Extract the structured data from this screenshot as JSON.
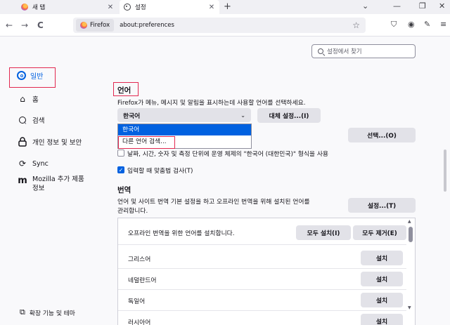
{
  "tabs": [
    {
      "title": "새 탭",
      "close": "✕"
    },
    {
      "title": "설정",
      "close": "✕"
    }
  ],
  "tabstrip": {
    "new_tab": "+",
    "list_all": "⌄",
    "minimize": "—",
    "restore": "❐",
    "close": "✕"
  },
  "nav": {
    "back": "←",
    "forward": "→",
    "reload": "C",
    "identity_label": "Firefox",
    "url": "about:preferences",
    "star": "☆",
    "icons": [
      "pocket-icon",
      "account-icon",
      "extensions-icon",
      "menu-icon"
    ]
  },
  "search": {
    "placeholder": "설정에서 찾기"
  },
  "sidebar": {
    "items": [
      {
        "label": "일반",
        "icon": "gear-icon",
        "selected": true
      },
      {
        "label": "홈",
        "icon": "home-icon"
      },
      {
        "label": "검색",
        "icon": "search-icon"
      },
      {
        "label": "개인 정보 및 보안",
        "icon": "lock-icon"
      },
      {
        "label": "Sync",
        "icon": "sync-icon"
      },
      {
        "label": "Mozilla 추가 제품",
        "label2": "정보",
        "icon": "mozilla-icon"
      }
    ],
    "bottom": "확장 기능 및 테마"
  },
  "language": {
    "heading": "언어",
    "description": "Firefox가 메뉴, 메시지 및 알림을 표시하는데 사용할 언어를 선택하세요.",
    "selected": "한국어",
    "alternatives_button": "대체 설정...(I)",
    "options": [
      "한국어",
      "다른 언어 검색..."
    ],
    "choose_button": "선택...(O)",
    "locale_checkbox": "날짜, 시간, 숫자 및 측정 단위에 운영 체제의 \"한국어 (대한민국)\" 형식을 사용",
    "spellcheck_checkbox": "입력할 때 맞춤법 검사(T)",
    "spellcheck_checked": true
  },
  "translation": {
    "heading": "번역",
    "description_line1": "언어 및 사이트 번역 기본 설정을 하고 오프라인 번역을 위해 설치된 언어를",
    "description_line2": "관리합니다.",
    "settings_button": "설정...(T)",
    "box_title": "오프라인 번역을 위한 언어를 설치합니다.",
    "install_all": "모두 설치(I)",
    "remove_all": "모두 제거(E)",
    "install_label": "설치",
    "languages": [
      "그리스어",
      "네덜란드어",
      "독일어",
      "러시아어"
    ]
  }
}
